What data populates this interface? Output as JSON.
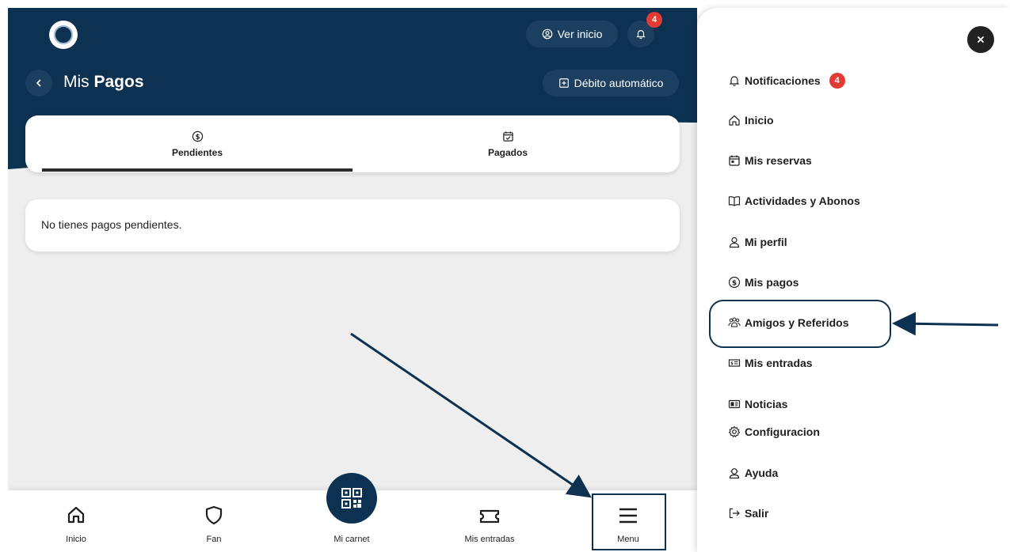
{
  "header": {
    "logo_icon": "club-crest-icon",
    "ver_inicio_label": "Ver inicio",
    "notifications_count": "4",
    "back_icon": "chevron-left-icon",
    "title_regular": "Mis ",
    "title_bold": "Pagos",
    "debito_label": "Débito automático"
  },
  "tabs": [
    {
      "label": "Pendientes",
      "icon": "dollar-circle-icon",
      "active": true
    },
    {
      "label": "Pagados",
      "icon": "calendar-check-icon",
      "active": false
    }
  ],
  "empty_message": "No tienes pagos pendientes.",
  "bottom_nav": [
    {
      "label": "Inicio",
      "icon": "home-icon"
    },
    {
      "label": "Fan",
      "icon": "shield-icon"
    },
    {
      "label": "Mi carnet",
      "icon": "qr-code-icon"
    },
    {
      "label": "Mis entradas",
      "icon": "ticket-icon"
    },
    {
      "label": "Menu",
      "icon": "hamburger-icon"
    }
  ],
  "drawer": {
    "close_icon": "close-icon",
    "notif_count": "4",
    "items": [
      {
        "label": "Notificaciones",
        "icon": "bell-icon"
      },
      {
        "label": "Inicio",
        "icon": "home-icon"
      },
      {
        "label": "Mis reservas",
        "icon": "calendar-icon"
      },
      {
        "label": "Actividades y Abonos",
        "icon": "book-icon"
      },
      {
        "label": "Mi perfil",
        "icon": "user-icon"
      },
      {
        "label": "Mis pagos",
        "icon": "dollar-circle-icon"
      },
      {
        "label": "Amigos y Referidos",
        "icon": "users-icon"
      },
      {
        "label": "Mis entradas",
        "icon": "ticket-icon"
      },
      {
        "label": "Noticias",
        "icon": "newspaper-icon"
      },
      {
        "label": "Configuracion",
        "icon": "gear-icon"
      },
      {
        "label": "Ayuda",
        "icon": "help-user-icon"
      },
      {
        "label": "Salir",
        "icon": "logout-icon"
      }
    ]
  },
  "colors": {
    "primary": "#0d3150",
    "badge": "#e23b36",
    "background": "#eeeeee"
  }
}
